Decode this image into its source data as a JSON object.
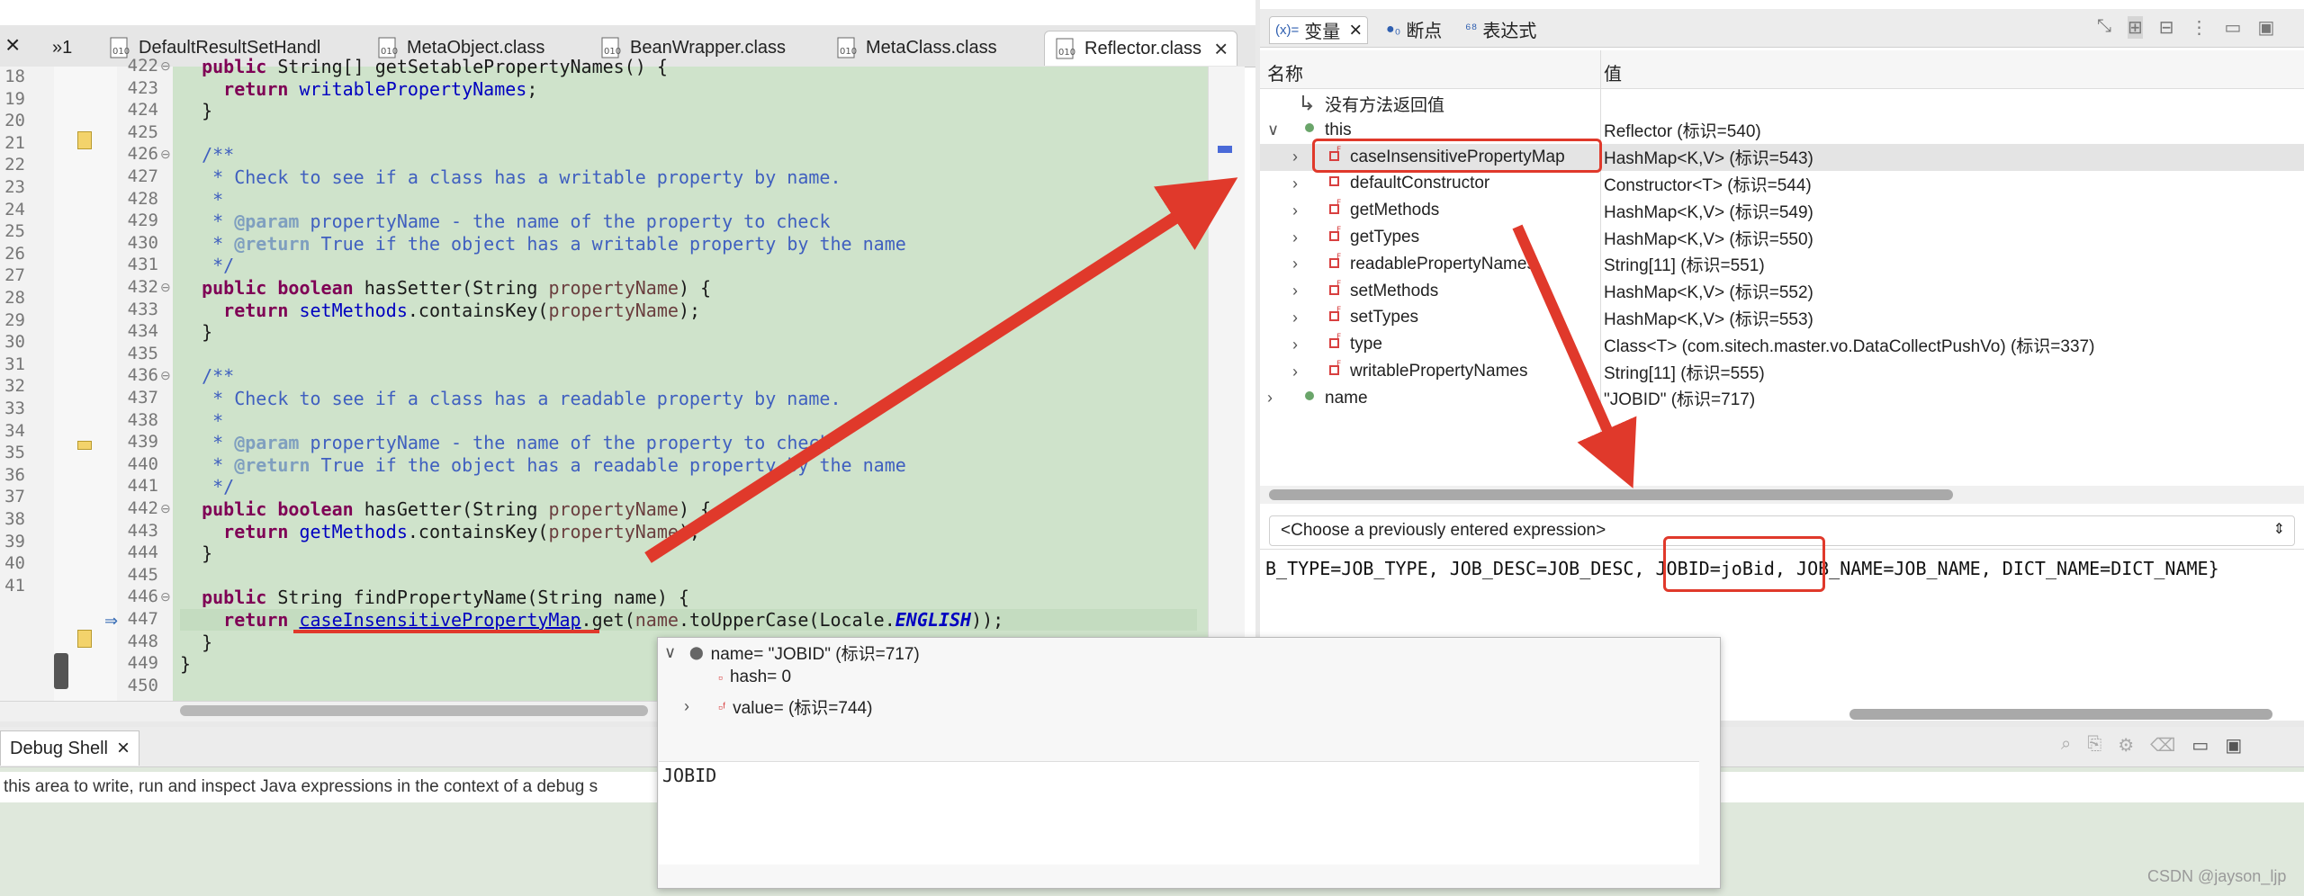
{
  "editor": {
    "tabs": [
      {
        "label": "»1"
      },
      {
        "label": "DefaultResultSetHandl"
      },
      {
        "label": "MetaObject.class"
      },
      {
        "label": "BeanWrapper.class"
      },
      {
        "label": "MetaClass.class"
      },
      {
        "label": "Reflector.class",
        "active": true
      }
    ],
    "close_glyph": "×",
    "outer_lines": [
      "18",
      "19",
      "20",
      "21",
      "22",
      "23",
      "24",
      "25",
      "26",
      "27",
      "28",
      "29",
      "30",
      "31",
      "32",
      "33",
      "34",
      "35",
      "36",
      "37",
      "38",
      "39",
      "40",
      "41"
    ],
    "lines": [
      {
        "n": "422",
        "text": "  public String[] getSetablePropertyNames() {"
      },
      {
        "n": "423",
        "text": "    return writablePropertyNames;"
      },
      {
        "n": "424",
        "text": "  }"
      },
      {
        "n": "425",
        "text": ""
      },
      {
        "n": "426",
        "text": "  /**"
      },
      {
        "n": "427",
        "text": "   * Check to see if a class has a writable property by name."
      },
      {
        "n": "428",
        "text": "   *"
      },
      {
        "n": "429",
        "text": "   * @param propertyName - the name of the property to check"
      },
      {
        "n": "430",
        "text": "   * @return True if the object has a writable property by the name"
      },
      {
        "n": "431",
        "text": "   */"
      },
      {
        "n": "432",
        "text": "  public boolean hasSetter(String propertyName) {"
      },
      {
        "n": "433",
        "text": "    return setMethods.containsKey(propertyName);"
      },
      {
        "n": "434",
        "text": "  }"
      },
      {
        "n": "435",
        "text": ""
      },
      {
        "n": "436",
        "text": "  /**"
      },
      {
        "n": "437",
        "text": "   * Check to see if a class has a readable property by name."
      },
      {
        "n": "438",
        "text": "   *"
      },
      {
        "n": "439",
        "text": "   * @param propertyName - the name of the property to check"
      },
      {
        "n": "440",
        "text": "   * @return True if the object has a readable property by the name"
      },
      {
        "n": "441",
        "text": "   */"
      },
      {
        "n": "442",
        "text": "  public boolean hasGetter(String propertyName) {"
      },
      {
        "n": "443",
        "text": "    return getMethods.containsKey(propertyName);"
      },
      {
        "n": "444",
        "text": "  }"
      },
      {
        "n": "445",
        "text": ""
      },
      {
        "n": "446",
        "text": "  public String findPropertyName(String name) {"
      },
      {
        "n": "447",
        "text": "    return caseInsensitivePropertyMap.get(name.toUpperCase(Locale.ENGLISH));"
      },
      {
        "n": "448",
        "text": "  }"
      },
      {
        "n": "449",
        "text": "}"
      },
      {
        "n": "450",
        "text": ""
      }
    ]
  },
  "variables": {
    "tabs": [
      {
        "label": "变量",
        "icon": "variables-icon"
      },
      {
        "label": "断点",
        "icon": "breakpoints-icon"
      },
      {
        "label": "表达式",
        "icon": "expressions-icon"
      }
    ],
    "col_name": "名称",
    "col_value": "值",
    "rows": [
      {
        "name": "没有方法返回值",
        "value": "",
        "indent": 0,
        "chev": "",
        "icon": "return-icon"
      },
      {
        "name": "this",
        "value": "Reflector  (标识=540)",
        "indent": 0,
        "chev": "∨",
        "icon": "local-icon"
      },
      {
        "name": "caseInsensitivePropertyMap",
        "value": "HashMap<K,V>  (标识=543)",
        "indent": 1,
        "chev": "›",
        "icon": "private-final-field-icon",
        "selected": true
      },
      {
        "name": "defaultConstructor",
        "value": "Constructor<T>  (标识=544)",
        "indent": 1,
        "chev": "›",
        "icon": "private-field-icon"
      },
      {
        "name": "getMethods",
        "value": "HashMap<K,V>  (标识=549)",
        "indent": 1,
        "chev": "›",
        "icon": "private-final-field-icon"
      },
      {
        "name": "getTypes",
        "value": "HashMap<K,V>  (标识=550)",
        "indent": 1,
        "chev": "›",
        "icon": "private-final-field-icon"
      },
      {
        "name": "readablePropertyNames",
        "value": "String[11]  (标识=551)",
        "indent": 1,
        "chev": "›",
        "icon": "private-final-field-icon"
      },
      {
        "name": "setMethods",
        "value": "HashMap<K,V>  (标识=552)",
        "indent": 1,
        "chev": "›",
        "icon": "private-final-field-icon"
      },
      {
        "name": "setTypes",
        "value": "HashMap<K,V>  (标识=553)",
        "indent": 1,
        "chev": "›",
        "icon": "private-final-field-icon"
      },
      {
        "name": "type",
        "value": "Class<T> (com.sitech.master.vo.DataCollectPushVo)  (标识=337)",
        "indent": 1,
        "chev": "›",
        "icon": "private-final-field-icon"
      },
      {
        "name": "writablePropertyNames",
        "value": "String[11]  (标识=555)",
        "indent": 1,
        "chev": "›",
        "icon": "private-final-field-icon"
      },
      {
        "name": "name",
        "value": "\"JOBID\"  (标识=717)",
        "indent": 0,
        "chev": "›",
        "icon": "local-icon"
      }
    ],
    "expr_placeholder": "<Choose a previously entered expression>",
    "detail": {
      "before": "B_TYPE=JOB_TYPE, JOB_DESC=JOB_DESC, ",
      "highlight": "JOBID=joBid,",
      "after": " JOB_NAME=JOB_NAME, DICT_NAME=DICT_NAME}"
    }
  },
  "shell": {
    "tab_label": "Debug Shell",
    "description": " this area to write, run and inspect Java expressions in the context of a debug s"
  },
  "popup": {
    "root": "name= \"JOBID\"  (标识=717)",
    "hash": "hash= 0",
    "value": "value=  (标识=744)",
    "text": "JOBID"
  },
  "watermark": "CSDN @jayson_ljp",
  "colors": {
    "annotation": "#e0392b",
    "code_bg": "#cfe3cb"
  }
}
